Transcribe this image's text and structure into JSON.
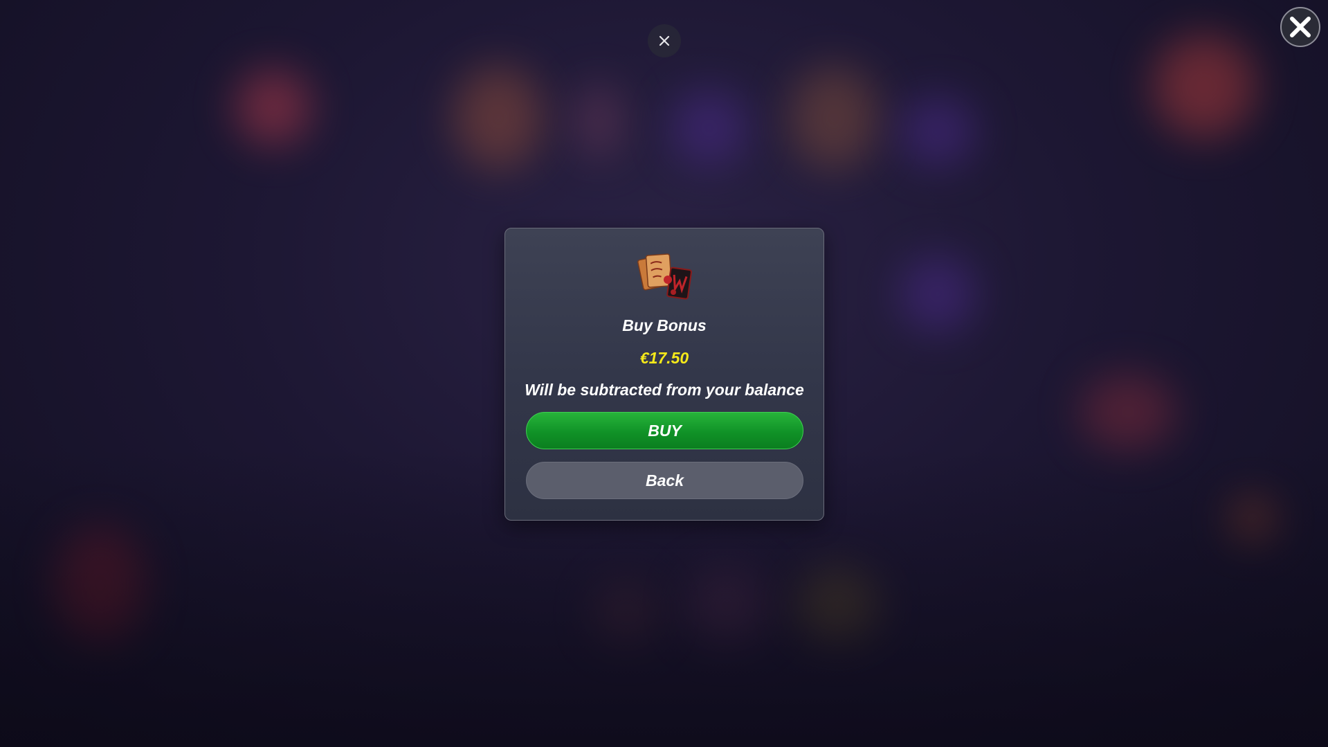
{
  "overlay": {
    "top_close_icon": "close-icon",
    "corner_close_icon": "close-icon"
  },
  "modal": {
    "icon": "bonus-cards-icon",
    "title": "Buy Bonus",
    "price": "€17.50",
    "note": "Will be subtracted from your balance",
    "buy_label": "BUY",
    "back_label": "Back"
  },
  "colors": {
    "price": "#f5e91a",
    "buy_button": "#16a02c",
    "back_button": "#5b5e6c",
    "modal_background": "#363a4c"
  }
}
